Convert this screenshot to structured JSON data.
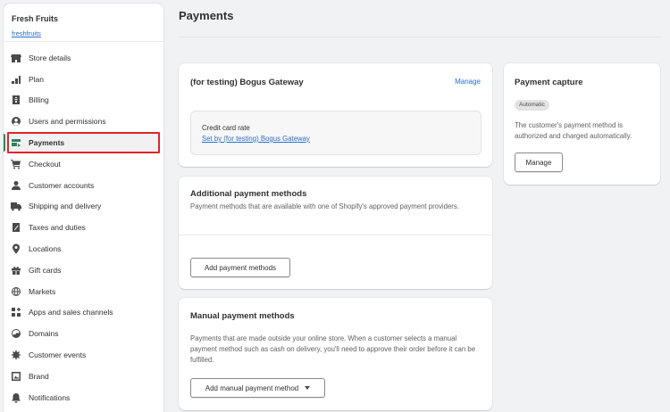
{
  "store": {
    "name": "Fresh Fruits",
    "handle": "freshfruits"
  },
  "sidebar": {
    "items": [
      {
        "label": "Store details",
        "icon": "store-icon"
      },
      {
        "label": "Plan",
        "icon": "plan-icon"
      },
      {
        "label": "Billing",
        "icon": "billing-icon"
      },
      {
        "label": "Users and permissions",
        "icon": "user-icon"
      },
      {
        "label": "Payments",
        "icon": "payments-icon"
      },
      {
        "label": "Checkout",
        "icon": "cart-icon"
      },
      {
        "label": "Customer accounts",
        "icon": "person-icon"
      },
      {
        "label": "Shipping and delivery",
        "icon": "truck-icon"
      },
      {
        "label": "Taxes and duties",
        "icon": "tax-icon"
      },
      {
        "label": "Locations",
        "icon": "location-icon"
      },
      {
        "label": "Gift cards",
        "icon": "gift-icon"
      },
      {
        "label": "Markets",
        "icon": "globe-icon"
      },
      {
        "label": "Apps and sales channels",
        "icon": "apps-icon"
      },
      {
        "label": "Domains",
        "icon": "domain-icon"
      },
      {
        "label": "Customer events",
        "icon": "events-icon"
      },
      {
        "label": "Brand",
        "icon": "brand-icon"
      },
      {
        "label": "Notifications",
        "icon": "bell-icon"
      }
    ],
    "active": "Payments"
  },
  "page": {
    "title": "Payments"
  },
  "gateway": {
    "title": "(for testing) Bogus Gateway",
    "manage_label": "Manage",
    "rate_label": "Credit card rate",
    "rate_link": "Set by (for testing) Bogus Gateway"
  },
  "additional": {
    "title": "Additional payment methods",
    "description": "Payment methods that are available with one of Shopify's approved payment providers.",
    "button_label": "Add payment methods"
  },
  "manual": {
    "title": "Manual payment methods",
    "description": "Payments that are made outside your online store. When a customer selects a manual payment method such as cash on delivery, you'll need to approve their order before it can be fulfilled.",
    "button_label": "Add manual payment method"
  },
  "capture": {
    "title": "Payment capture",
    "badge": "Automatic",
    "description": "The customer's payment method is authorized and charged automatically.",
    "button_label": "Manage"
  },
  "colors": {
    "accent": "#2c6ecb",
    "active_bar": "#29845a",
    "highlight": "#e0242a"
  }
}
